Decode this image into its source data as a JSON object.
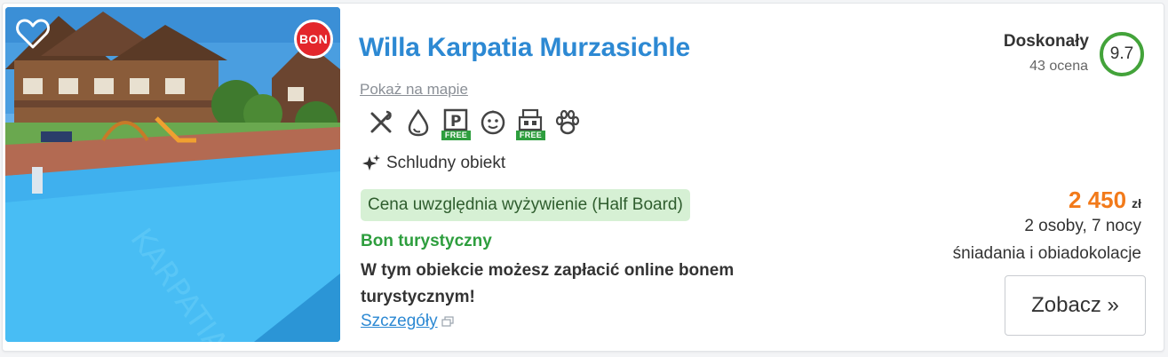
{
  "hotel": {
    "name": "Willa Karpatia Murzasichle",
    "map_link": "Pokaż na mapie",
    "badge": "BON",
    "feature": "Schludny obiekt",
    "meal_badge": "Cena uwzględnia wyżywienie (Half Board)",
    "bon": {
      "title": "Bon turystyczny",
      "description": "W tym obiekcie możesz zapłacić online bonem turystycznym!",
      "details_link": "Szczegóły"
    }
  },
  "amenities": [
    {
      "icon": "restaurant-icon",
      "free": ""
    },
    {
      "icon": "spa-icon",
      "free": ""
    },
    {
      "icon": "parking-icon",
      "free": "FREE"
    },
    {
      "icon": "kids-icon",
      "free": ""
    },
    {
      "icon": "wifi-icon",
      "free": "FREE"
    },
    {
      "icon": "pets-icon",
      "free": ""
    }
  ],
  "rating": {
    "label": "Doskonały",
    "count": "43 ocena",
    "score": "9.7"
  },
  "price": {
    "amount": "2 450",
    "currency": "zł",
    "guests": "2 osoby, 7 nocy",
    "board": "śniadania i obiadokolacje"
  },
  "cta": {
    "label": "Zobacz »"
  },
  "colors": {
    "title": "#2d89d3",
    "price": "#f27a1a",
    "bon_green": "#2e9e3e",
    "score_ring": "#43a33a",
    "badge_red": "#e3262b"
  }
}
